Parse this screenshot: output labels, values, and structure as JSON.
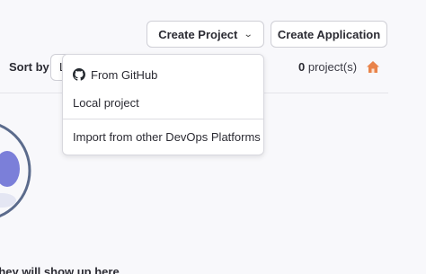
{
  "toolbar": {
    "create_project_label": "Create Project",
    "create_application_label": "Create Application"
  },
  "sort": {
    "label": "Sort by",
    "selected_value": "L"
  },
  "projects": {
    "count": "0",
    "unit": "project(s)"
  },
  "dropdown": {
    "items": [
      {
        "label": "From GitHub",
        "icon": "github-icon"
      },
      {
        "label": "Local project"
      },
      {
        "label": "Import from other DevOps Platforms"
      }
    ]
  },
  "empty_state": {
    "text_fragment": "they will show up here"
  },
  "colors": {
    "accent": "#e9834a",
    "background": "#f8f8fb",
    "illustration_ring": "#5b6b8c",
    "illustration_fill": "#7b7fd9"
  }
}
